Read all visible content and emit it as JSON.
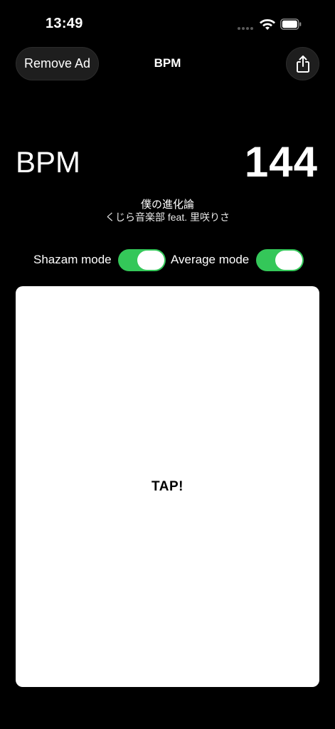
{
  "status_bar": {
    "time": "13:49"
  },
  "header": {
    "remove_ad_label": "Remove Ad",
    "title": "BPM",
    "share_icon": "share-icon"
  },
  "bpm": {
    "label": "BPM",
    "value": "144"
  },
  "song": {
    "title": "僕の進化論",
    "artist": "くじら音楽部 feat. 里咲りさ"
  },
  "modes": {
    "shazam_label": "Shazam mode",
    "shazam_on": true,
    "average_label": "Average mode",
    "average_on": true
  },
  "tap": {
    "label": "TAP!"
  },
  "colors": {
    "background": "#000000",
    "toggle_on": "#34c759",
    "tap_area": "#ffffff"
  }
}
